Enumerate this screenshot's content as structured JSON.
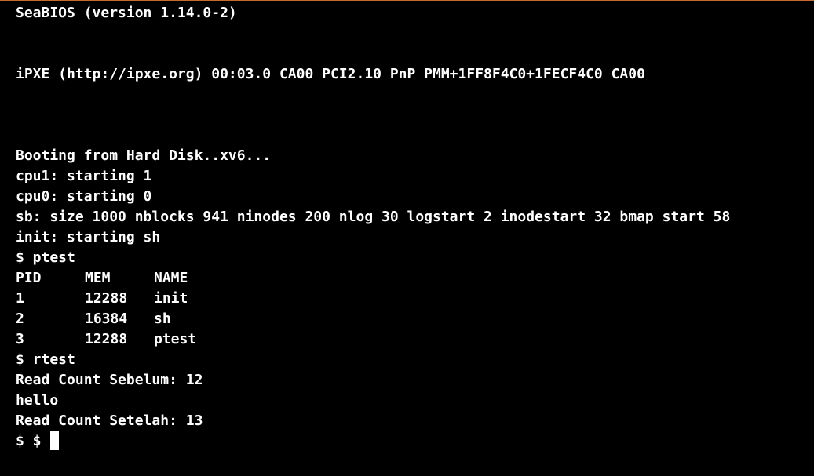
{
  "theme": {
    "background": "#000000",
    "foreground": "#ffffff",
    "border_accent": "#c86a2e"
  },
  "console": {
    "bios": "SeaBIOS (version 1.14.0-2)",
    "ipxe": "iPXE (http://ipxe.org) 00:03.0 CA00 PCI2.10 PnP PMM+1FF8F4C0+1FECF4C0 CA00",
    "booting": "Booting from Hard Disk..xv6...",
    "cpu1": "cpu1: starting 1",
    "cpu0": "cpu0: starting 0",
    "superblock": "sb: size 1000 nblocks 941 ninodes 200 nlog 30 logstart 2 inodestart 32 bmap start 58",
    "init": "init: starting sh",
    "cmd_ptest": "$ ptest",
    "ptest_table": {
      "headers": [
        "PID",
        "MEM",
        "NAME"
      ],
      "rows": [
        [
          "1",
          "12288",
          "init"
        ],
        [
          "2",
          "16384",
          "sh"
        ],
        [
          "3",
          "12288",
          "ptest"
        ]
      ]
    },
    "cmd_rtest": "$ rtest",
    "read_before": "Read Count Sebelum: 12",
    "hello": "hello",
    "read_after": "Read Count Setelah: 13",
    "prompt": "$ $ "
  },
  "cursor_icon": "block-cursor-icon"
}
